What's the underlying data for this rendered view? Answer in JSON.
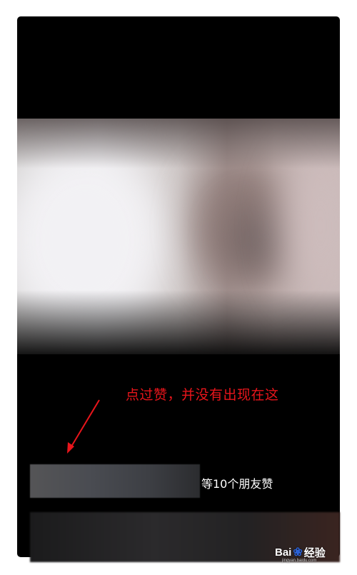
{
  "annotation": {
    "text": "点过赞，并没有出现在这",
    "color": "#e8151b"
  },
  "likes": {
    "summary": "等10个朋友赞"
  },
  "watermark": {
    "brand": "Bai",
    "icon": "paw-icon",
    "suffix": "经验",
    "url": "jingyan.baidu.com"
  }
}
